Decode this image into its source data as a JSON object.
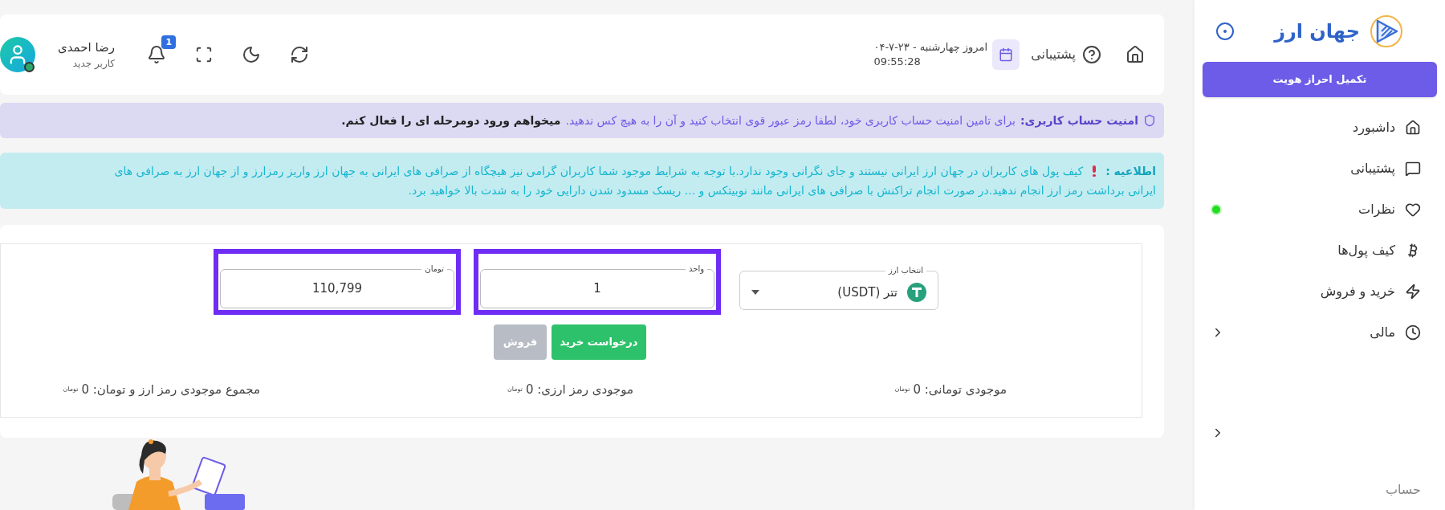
{
  "header": {
    "support_label": "پشتیبانی",
    "date": "امروز چهارشنبه - ۲۳-۷-۰۴",
    "time": "09:55:28",
    "notifications": "1",
    "user": {
      "name": "رضا احمدی",
      "role": "کاربر جدید",
      "online": true
    }
  },
  "alerts": [
    {
      "kind": "security",
      "title": "امنیت حساب کاربری:",
      "lines": [
        "برای تامین امنیت حساب کاربری خود، لطفا رمز عبور قوی انتخاب کنید و آن را به هیچ کس ندهید."
      ],
      "link": "میخواهم ورود دومرحله ای را فعال کنم."
    },
    {
      "kind": "info",
      "title": "اطلاعیه :",
      "lines": [
        "کیف پول های کاربران در جهان ارز ایرانی نیستند و جای نگرانی وجود ندارد.با توجه به شرایط موجود شما کاربران گرامی نیز هیچگاه از صرافی های ایرانی به جهان ارز واریز رمزارز و از جهان ارز به صرافی های",
        "ایرانی برداشت رمز ارز انجام ندهید.در صورت انجام تراکنش با صرافی های ایرانی مانند نوبیتکس و ... ریسک مسدود شدن دارایی خود را به شدت بالا خواهید برد."
      ]
    }
  ],
  "trade": {
    "currency": {
      "label": "انتخاب ارز",
      "value": "تتر (USDT)"
    },
    "fields": [
      {
        "label": "واحد",
        "value": "1",
        "highlighted": true
      },
      {
        "label": "تومان",
        "value": "110,799",
        "highlighted": true
      }
    ],
    "buttons": [
      {
        "label": "درخواست خرید",
        "kind": "buy",
        "disabled": false
      },
      {
        "label": "فروش",
        "kind": "sell",
        "disabled": true
      }
    ],
    "balances": [
      {
        "label": "موجودی تومانی: 0",
        "unit": "تومان"
      },
      {
        "label": "موجودی رمز ارزی: 0",
        "unit": "تومان"
      },
      {
        "label": "مجموع موجودی رمز ارز و تومان: 0",
        "unit": "تومان"
      }
    ]
  },
  "sidebar": {
    "brand": "جهان ارز",
    "verify_button": "تکمیل احراز هویت",
    "items": [
      {
        "label": "داشبورد",
        "expandable": false,
        "notify": false
      },
      {
        "label": "پشتیبانی",
        "expandable": false,
        "notify": false
      },
      {
        "label": "نظرات",
        "expandable": false,
        "notify": true
      },
      {
        "label": "کیف پول‌ها",
        "expandable": false,
        "notify": false
      },
      {
        "label": "خرید و فروش",
        "expandable": false,
        "notify": false
      },
      {
        "label": "مالی",
        "expandable": true,
        "notify": false
      },
      {
        "expandable": true,
        "notify": false
      },
      {
        "label": "حساب",
        "expandable": false,
        "notify": false
      }
    ]
  }
}
